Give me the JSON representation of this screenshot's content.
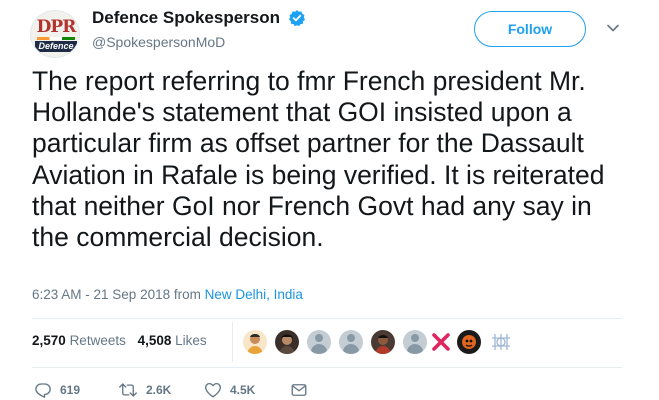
{
  "account": {
    "display_name": "Defence Spokesperson",
    "handle": "@SpokespersonMoD",
    "avatar_text_top": "DPR",
    "avatar_text_bottom": "Defence"
  },
  "follow_label": "Follow",
  "tweet": {
    "text": "The report referring to  fmr French president Mr. Hollande's statement that GOI insisted upon a particular firm as offset partner for the Dassault Aviation in Rafale is being verified. It is reiterated that neither GoI nor French Govt had any say in the commercial decision."
  },
  "meta": {
    "time": "6:23 AM - 21 Sep 2018",
    "from_word": "from",
    "location": "New Delhi, India"
  },
  "stats": {
    "retweets_count": "2,570",
    "retweets_label": "Retweets",
    "likes_count": "4,508",
    "likes_label": "Likes"
  },
  "actions": {
    "replies": "619",
    "retweets": "2.6K",
    "likes": "4.5K"
  },
  "colors": {
    "accent": "#1da1f2",
    "text": "#14171a",
    "muted": "#657786",
    "divider": "#e6ecf0"
  }
}
